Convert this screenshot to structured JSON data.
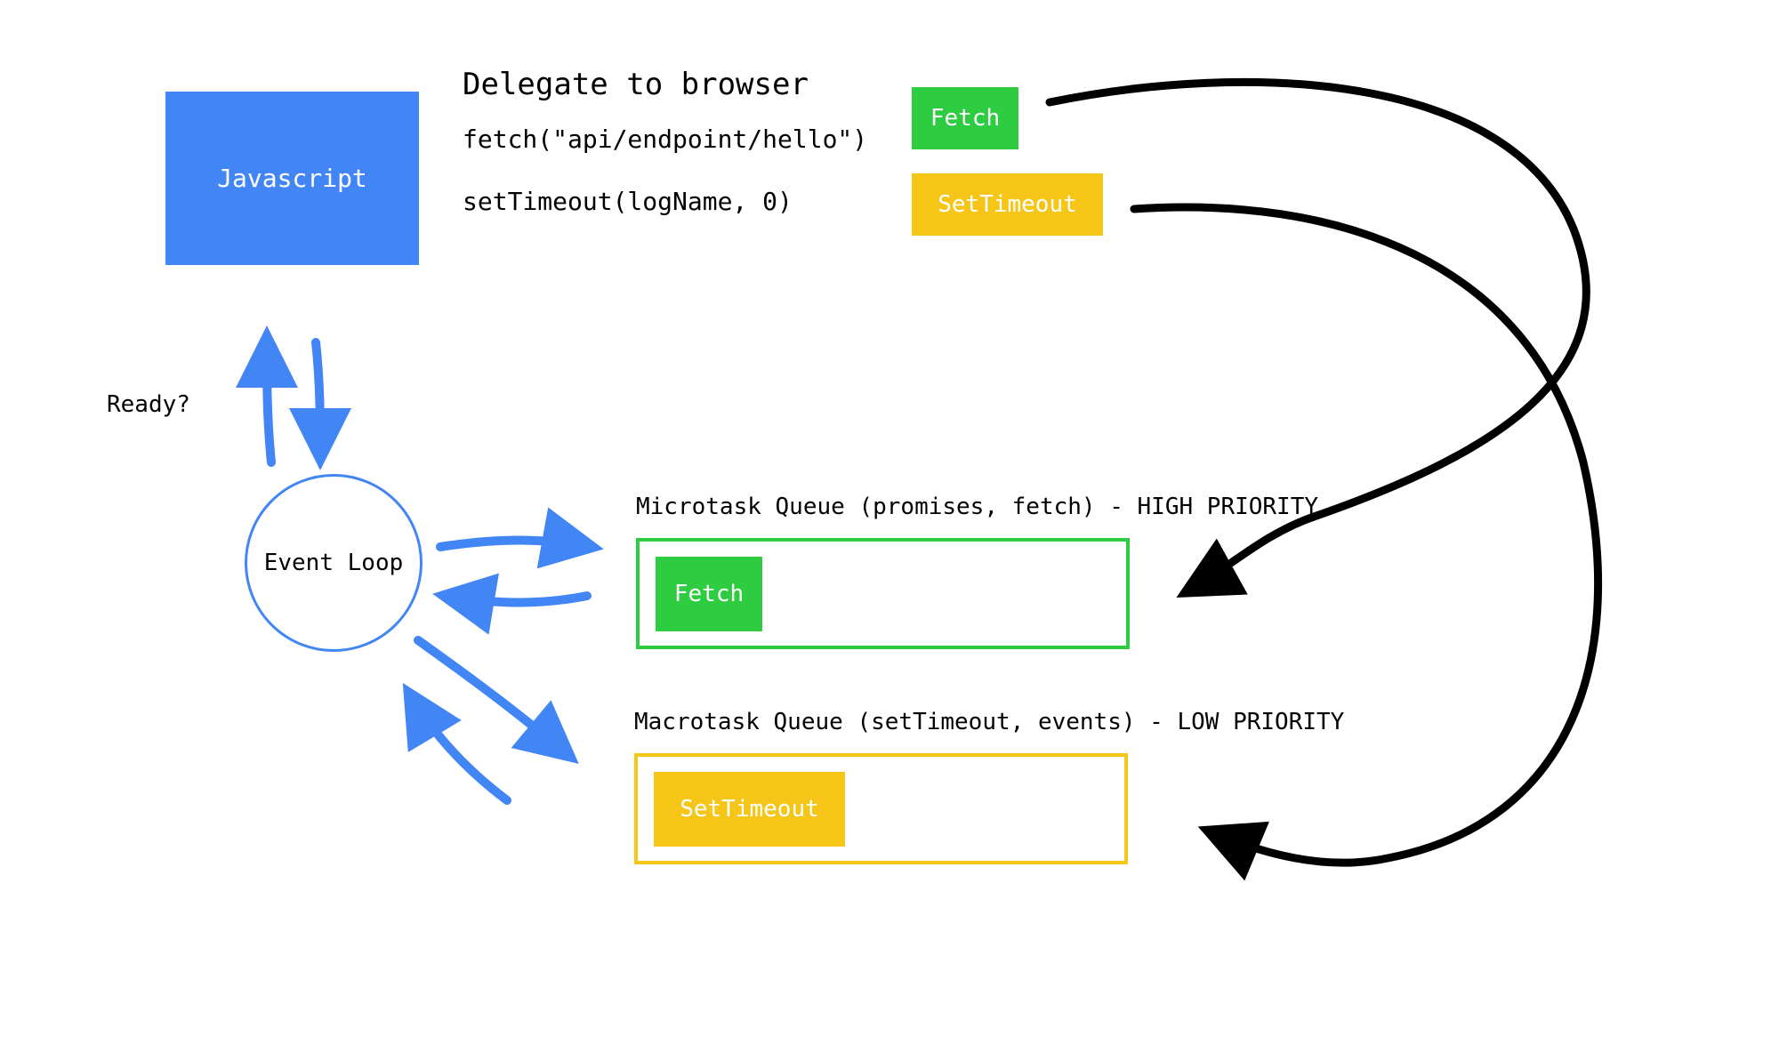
{
  "javascript_box": {
    "label": "Javascript"
  },
  "delegate_heading": "Delegate to browser",
  "code": {
    "line1": "fetch(\"api/endpoint/hello\")",
    "line2": "setTimeout(logName, 0)"
  },
  "browser_tasks": {
    "fetch_label": "Fetch",
    "settimeout_label": "SetTimeout"
  },
  "ready_label": "Ready?",
  "event_loop_label": "Event Loop",
  "microtask": {
    "title": "Microtask Queue (promises, fetch) - HIGH PRIORITY",
    "item_label": "Fetch"
  },
  "macrotask": {
    "title": "Macrotask Queue (setTimeout, events) - LOW PRIORITY",
    "item_label": "SetTimeout"
  },
  "colors": {
    "blue": "#4285f4",
    "green": "#2ecc40",
    "yellow": "#f5c518",
    "black": "#000000"
  }
}
